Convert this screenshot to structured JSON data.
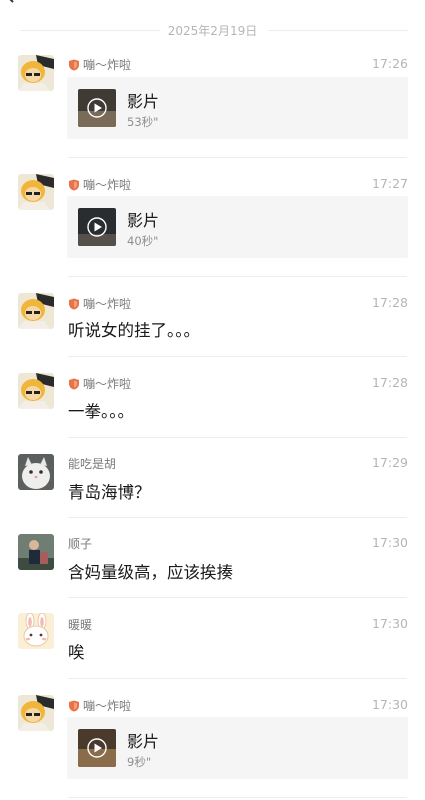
{
  "header": {
    "date_separator": "2025年2月19日",
    "back_icon": "chevron-left-icon"
  },
  "colors": {
    "name_badge": "#e8734a",
    "card_bg": "#f5f5f5"
  },
  "messages": [
    {
      "sender": "嘣～炸啦",
      "time": "17:26",
      "type": "video",
      "video_label": "影片",
      "duration": "53秒\""
    },
    {
      "sender": "嘣～炸啦",
      "time": "17:27",
      "type": "video",
      "video_label": "影片",
      "duration": "40秒\""
    },
    {
      "sender": "嘣～炸啦",
      "time": "17:28",
      "type": "text",
      "text": "听说女的挂了。。。"
    },
    {
      "sender": "嘣～炸啦",
      "time": "17:28",
      "type": "text",
      "text": "一拳。。。"
    },
    {
      "sender": "能吃是胡",
      "time": "17:29",
      "type": "text",
      "text": "青岛海博？"
    },
    {
      "sender": "顺子",
      "time": "17:30",
      "type": "text",
      "text": "含妈量级高，应该挨揍"
    },
    {
      "sender": "暖暖",
      "time": "17:30",
      "type": "text",
      "text": "唉"
    },
    {
      "sender": "嘣～炸啦",
      "time": "17:30",
      "type": "video",
      "video_label": "影片",
      "duration": "9秒\""
    }
  ]
}
